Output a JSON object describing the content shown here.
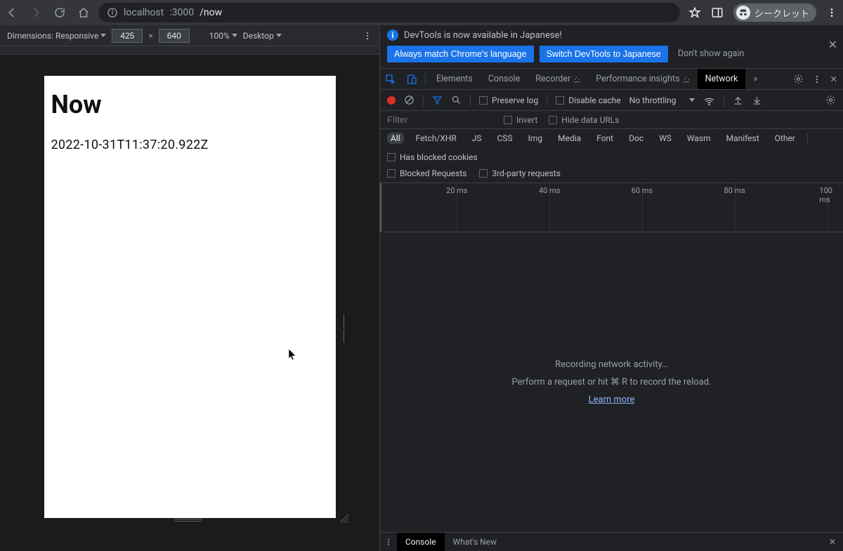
{
  "browser": {
    "url_host": "localhost",
    "url_port": ":3000",
    "url_path": "/now",
    "incognito_label": "シークレット"
  },
  "device_toolbar": {
    "dimensions_label": "Dimensions: Responsive",
    "width": "425",
    "height": "640",
    "separator": "×",
    "zoom": "100%",
    "device_type": "Desktop"
  },
  "page": {
    "title": "Now",
    "timestamp": "2022-10-31T11:37:20.922Z"
  },
  "infobar": {
    "message": "DevTools is now available in Japanese!",
    "btn_match": "Always match Chrome's language",
    "btn_switch": "Switch DevTools to Japanese",
    "dont_show": "Don't show again"
  },
  "tabs": {
    "elements": "Elements",
    "console": "Console",
    "recorder": "Recorder",
    "perf_insights": "Performance insights",
    "network": "Network"
  },
  "net_toolbar": {
    "preserve_log": "Preserve log",
    "disable_cache": "Disable cache",
    "throttling": "No throttling"
  },
  "filter": {
    "placeholder": "Filter",
    "invert": "Invert",
    "hide_data_urls": "Hide data URLs",
    "has_blocked": "Has blocked cookies",
    "blocked_requests": "Blocked Requests",
    "third_party": "3rd-party requests"
  },
  "types": [
    "All",
    "Fetch/XHR",
    "JS",
    "CSS",
    "Img",
    "Media",
    "Font",
    "Doc",
    "WS",
    "Wasm",
    "Manifest",
    "Other"
  ],
  "timeline_marks": [
    "20 ms",
    "40 ms",
    "60 ms",
    "80 ms",
    "100 ms"
  ],
  "empty": {
    "line1": "Recording network activity…",
    "line2a": "Perform a request or hit ",
    "line2b": "⌘ R",
    "line2c": " to record the reload.",
    "learn_more": "Learn more"
  },
  "drawer": {
    "console": "Console",
    "whats_new": "What's New"
  }
}
